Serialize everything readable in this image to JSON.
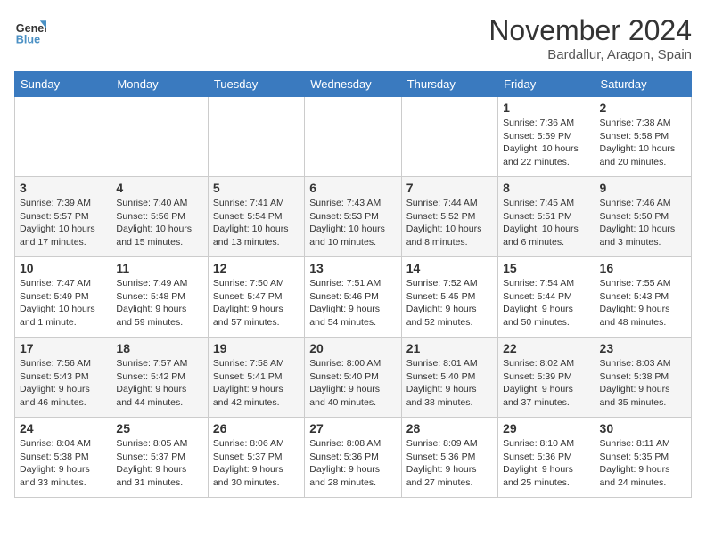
{
  "header": {
    "logo_line1": "General",
    "logo_line2": "Blue",
    "month": "November 2024",
    "location": "Bardallur, Aragon, Spain"
  },
  "weekdays": [
    "Sunday",
    "Monday",
    "Tuesday",
    "Wednesday",
    "Thursday",
    "Friday",
    "Saturday"
  ],
  "weeks": [
    [
      {
        "day": "",
        "info": ""
      },
      {
        "day": "",
        "info": ""
      },
      {
        "day": "",
        "info": ""
      },
      {
        "day": "",
        "info": ""
      },
      {
        "day": "",
        "info": ""
      },
      {
        "day": "1",
        "info": "Sunrise: 7:36 AM\nSunset: 5:59 PM\nDaylight: 10 hours and 22 minutes."
      },
      {
        "day": "2",
        "info": "Sunrise: 7:38 AM\nSunset: 5:58 PM\nDaylight: 10 hours and 20 minutes."
      }
    ],
    [
      {
        "day": "3",
        "info": "Sunrise: 7:39 AM\nSunset: 5:57 PM\nDaylight: 10 hours and 17 minutes."
      },
      {
        "day": "4",
        "info": "Sunrise: 7:40 AM\nSunset: 5:56 PM\nDaylight: 10 hours and 15 minutes."
      },
      {
        "day": "5",
        "info": "Sunrise: 7:41 AM\nSunset: 5:54 PM\nDaylight: 10 hours and 13 minutes."
      },
      {
        "day": "6",
        "info": "Sunrise: 7:43 AM\nSunset: 5:53 PM\nDaylight: 10 hours and 10 minutes."
      },
      {
        "day": "7",
        "info": "Sunrise: 7:44 AM\nSunset: 5:52 PM\nDaylight: 10 hours and 8 minutes."
      },
      {
        "day": "8",
        "info": "Sunrise: 7:45 AM\nSunset: 5:51 PM\nDaylight: 10 hours and 6 minutes."
      },
      {
        "day": "9",
        "info": "Sunrise: 7:46 AM\nSunset: 5:50 PM\nDaylight: 10 hours and 3 minutes."
      }
    ],
    [
      {
        "day": "10",
        "info": "Sunrise: 7:47 AM\nSunset: 5:49 PM\nDaylight: 10 hours and 1 minute."
      },
      {
        "day": "11",
        "info": "Sunrise: 7:49 AM\nSunset: 5:48 PM\nDaylight: 9 hours and 59 minutes."
      },
      {
        "day": "12",
        "info": "Sunrise: 7:50 AM\nSunset: 5:47 PM\nDaylight: 9 hours and 57 minutes."
      },
      {
        "day": "13",
        "info": "Sunrise: 7:51 AM\nSunset: 5:46 PM\nDaylight: 9 hours and 54 minutes."
      },
      {
        "day": "14",
        "info": "Sunrise: 7:52 AM\nSunset: 5:45 PM\nDaylight: 9 hours and 52 minutes."
      },
      {
        "day": "15",
        "info": "Sunrise: 7:54 AM\nSunset: 5:44 PM\nDaylight: 9 hours and 50 minutes."
      },
      {
        "day": "16",
        "info": "Sunrise: 7:55 AM\nSunset: 5:43 PM\nDaylight: 9 hours and 48 minutes."
      }
    ],
    [
      {
        "day": "17",
        "info": "Sunrise: 7:56 AM\nSunset: 5:43 PM\nDaylight: 9 hours and 46 minutes."
      },
      {
        "day": "18",
        "info": "Sunrise: 7:57 AM\nSunset: 5:42 PM\nDaylight: 9 hours and 44 minutes."
      },
      {
        "day": "19",
        "info": "Sunrise: 7:58 AM\nSunset: 5:41 PM\nDaylight: 9 hours and 42 minutes."
      },
      {
        "day": "20",
        "info": "Sunrise: 8:00 AM\nSunset: 5:40 PM\nDaylight: 9 hours and 40 minutes."
      },
      {
        "day": "21",
        "info": "Sunrise: 8:01 AM\nSunset: 5:40 PM\nDaylight: 9 hours and 38 minutes."
      },
      {
        "day": "22",
        "info": "Sunrise: 8:02 AM\nSunset: 5:39 PM\nDaylight: 9 hours and 37 minutes."
      },
      {
        "day": "23",
        "info": "Sunrise: 8:03 AM\nSunset: 5:38 PM\nDaylight: 9 hours and 35 minutes."
      }
    ],
    [
      {
        "day": "24",
        "info": "Sunrise: 8:04 AM\nSunset: 5:38 PM\nDaylight: 9 hours and 33 minutes."
      },
      {
        "day": "25",
        "info": "Sunrise: 8:05 AM\nSunset: 5:37 PM\nDaylight: 9 hours and 31 minutes."
      },
      {
        "day": "26",
        "info": "Sunrise: 8:06 AM\nSunset: 5:37 PM\nDaylight: 9 hours and 30 minutes."
      },
      {
        "day": "27",
        "info": "Sunrise: 8:08 AM\nSunset: 5:36 PM\nDaylight: 9 hours and 28 minutes."
      },
      {
        "day": "28",
        "info": "Sunrise: 8:09 AM\nSunset: 5:36 PM\nDaylight: 9 hours and 27 minutes."
      },
      {
        "day": "29",
        "info": "Sunrise: 8:10 AM\nSunset: 5:36 PM\nDaylight: 9 hours and 25 minutes."
      },
      {
        "day": "30",
        "info": "Sunrise: 8:11 AM\nSunset: 5:35 PM\nDaylight: 9 hours and 24 minutes."
      }
    ]
  ]
}
